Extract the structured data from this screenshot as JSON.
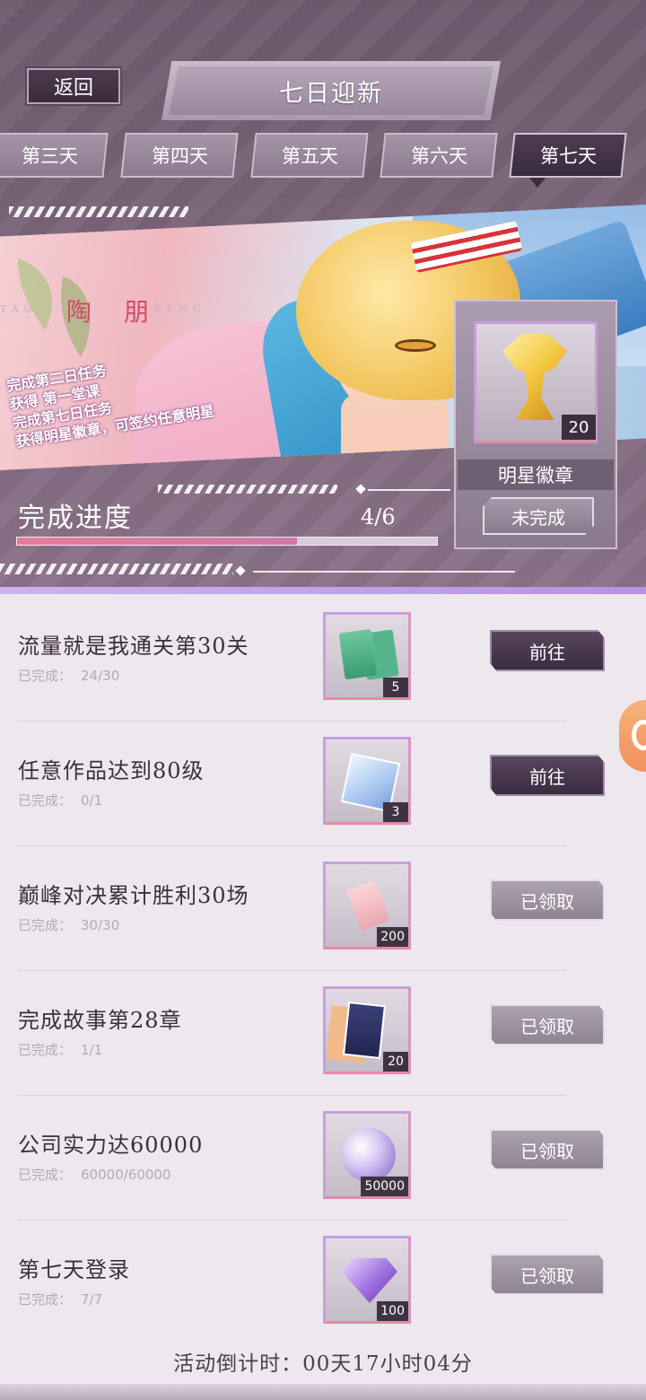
{
  "header": {
    "back_label": "返回",
    "title": "七日迎新",
    "tabs": [
      {
        "label": "第三天",
        "active": false
      },
      {
        "label": "第四天",
        "active": false
      },
      {
        "label": "第五天",
        "active": false
      },
      {
        "label": "第六天",
        "active": false
      },
      {
        "label": "第七天",
        "active": true
      }
    ]
  },
  "banner": {
    "name_pinyin_left": "TAO",
    "name_cn_1": "陶",
    "name_cn_2": "朋",
    "name_pinyin_right": "PENG",
    "text_lines": [
      "完成第二日任务",
      "获得 第一堂课",
      "完成第七日任务",
      "获得明星徽章，可签约任意明星"
    ]
  },
  "reward": {
    "icon": "star-badge-trophy-icon",
    "count": "20",
    "name": "明星徽章",
    "status": "未完成"
  },
  "progress": {
    "label": "完成进度",
    "value_text": "4/6",
    "completed": 4,
    "total": 6
  },
  "tasks": [
    {
      "title": "流量就是我通关第30关",
      "progress_label": "已完成：",
      "progress": "24/30",
      "reward_icon": "ticket-icon",
      "reward_count": "5",
      "button": "前往",
      "state": "go"
    },
    {
      "title": "任意作品达到80级",
      "progress_label": "已完成：",
      "progress": "0/1",
      "reward_icon": "crystal-cube-icon",
      "reward_count": "3",
      "button": "前往",
      "state": "go"
    },
    {
      "title": "巅峰对决累计胜利30场",
      "progress_label": "已完成：",
      "progress": "30/30",
      "reward_icon": "tag-icon",
      "reward_count": "200",
      "button": "已领取",
      "state": "claimed"
    },
    {
      "title": "完成故事第28章",
      "progress_label": "已完成：",
      "progress": "1/1",
      "reward_icon": "photo-cards-icon",
      "reward_count": "20",
      "button": "已领取",
      "state": "claimed"
    },
    {
      "title": "公司实力达60000",
      "progress_label": "已完成：",
      "progress": "60000/60000",
      "reward_icon": "crystal-orb-icon",
      "reward_count": "50000",
      "button": "已领取",
      "state": "claimed"
    },
    {
      "title": "第七天登录",
      "progress_label": "已完成：",
      "progress": "7/7",
      "reward_icon": "diamond-icon",
      "reward_count": "100",
      "button": "已领取",
      "state": "claimed"
    }
  ],
  "countdown": "活动倒计时：00天17小时04分",
  "colors": {
    "header_bg": "#7b6479",
    "accent_pink": "#e57c98",
    "active_tab": "#3b2b3f",
    "list_bg": "#ece8ee"
  }
}
